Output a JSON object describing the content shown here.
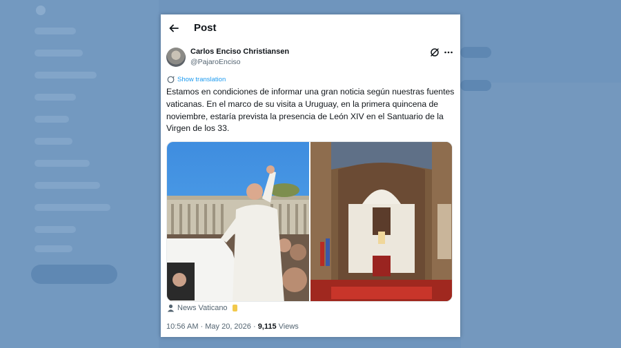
{
  "header": {
    "title": "Post",
    "back_icon": "arrow-left-icon"
  },
  "author": {
    "name": "Carlos Enciso Christiansen",
    "handle": "@PajaroEnciso"
  },
  "actions": {
    "grok_icon": "grok-icon",
    "more_icon": "more-horizontal-icon"
  },
  "translation": {
    "label": "Show translation",
    "icon": "globe-icon"
  },
  "tweet": {
    "text": "Estamos en condiciones de informar una gran noticia según nuestras fuentes vaticanas. En el marco de su visita a Uruguay, en la primera quincena de noviembre, estaría prevista la presencia de León XIV en el Santuario de la Virgen de los 33."
  },
  "media": {
    "images": [
      {
        "subject": "pope-waving-photo"
      },
      {
        "subject": "church-altar-photo"
      }
    ]
  },
  "source": {
    "label": "News Vaticano",
    "icon": "person-icon",
    "badge_color": "#f2c94c"
  },
  "meta": {
    "timestamp": "10:56 AM · May 20, 2026 · ",
    "views_count": "9,115",
    "views_label": " Views"
  },
  "colors": {
    "accent": "#1d9bf0",
    "text": "#0f1419",
    "muted": "#536471",
    "background": "#6f95bd"
  }
}
